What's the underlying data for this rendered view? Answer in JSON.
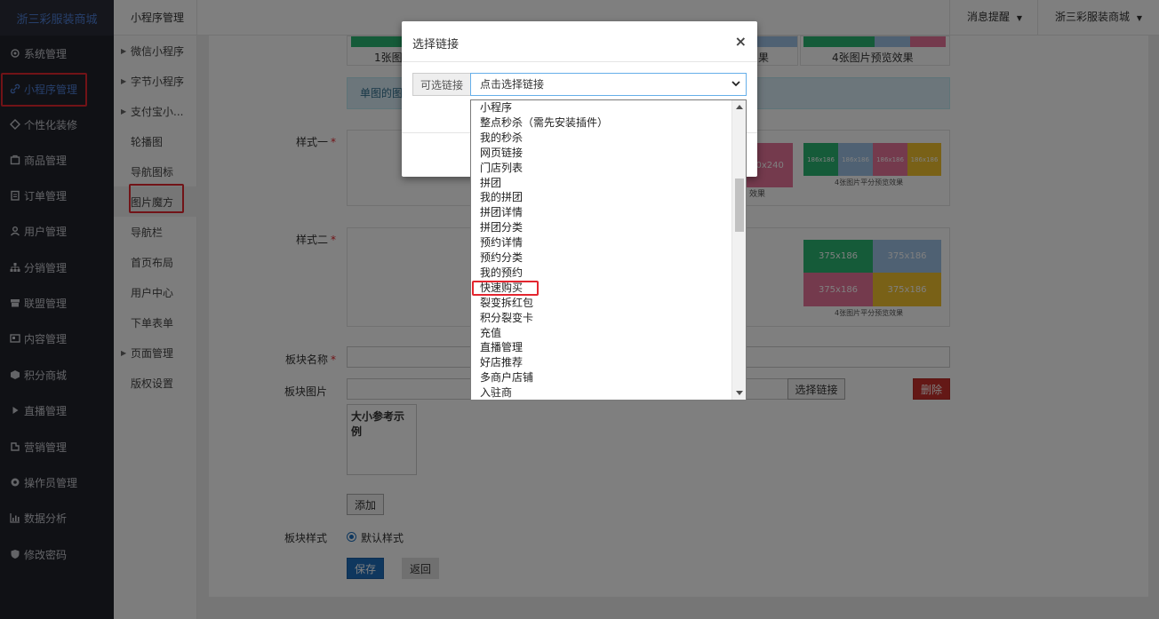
{
  "brand": "浙三彩服装商城",
  "nav": [
    {
      "label": "系统管理",
      "icon": "gear-icon"
    },
    {
      "label": "小程序管理",
      "icon": "link-icon"
    },
    {
      "label": "个性化装修",
      "icon": "diamond-icon"
    },
    {
      "label": "商品管理",
      "icon": "box-icon"
    },
    {
      "label": "订单管理",
      "icon": "clipboard-icon"
    },
    {
      "label": "用户管理",
      "icon": "user-icon"
    },
    {
      "label": "分销管理",
      "icon": "sitemap-icon"
    },
    {
      "label": "联盟管理",
      "icon": "store-icon"
    },
    {
      "label": "内容管理",
      "icon": "newspaper-icon"
    },
    {
      "label": "积分商城",
      "icon": "cube-icon"
    },
    {
      "label": "直播管理",
      "icon": "play-icon"
    },
    {
      "label": "营销管理",
      "icon": "stamp-icon"
    },
    {
      "label": "操作员管理",
      "icon": "cog-icon"
    },
    {
      "label": "数据分析",
      "icon": "bar-chart-icon"
    },
    {
      "label": "修改密码",
      "icon": "shield-icon"
    }
  ],
  "subnav": {
    "title": "小程序管理",
    "items": [
      {
        "label": "微信小程序",
        "arrow": true
      },
      {
        "label": "字节小程序",
        "arrow": true
      },
      {
        "label": "支付宝小...",
        "arrow": true
      },
      {
        "label": "轮播图",
        "arrow": false
      },
      {
        "label": "导航图标",
        "arrow": false
      },
      {
        "label": "图片魔方",
        "arrow": false
      },
      {
        "label": "导航栏",
        "arrow": false
      },
      {
        "label": "首页布局",
        "arrow": false
      },
      {
        "label": "用户中心",
        "arrow": false
      },
      {
        "label": "下单表单",
        "arrow": false
      },
      {
        "label": "页面管理",
        "arrow": true
      },
      {
        "label": "版权设置",
        "arrow": false
      }
    ]
  },
  "topbar": {
    "notifications": "消息提醒",
    "store": "浙三彩服装商城"
  },
  "content": {
    "preview1_caption_left": "1张图",
    "preview1_caption_mid": "果",
    "preview1_caption_right": "4张图片预览效果",
    "info_text": "单图的图",
    "style1_label": "样式一",
    "style1_tile_text_a": "50x240",
    "style1_caption_mid": "效果",
    "style1_tiles": [
      "186x186",
      "186x186",
      "186x186",
      "186x186"
    ],
    "style1_caption_right": "4张图片平分预览效果",
    "style2_label": "样式二",
    "style2_tiles": [
      "375x186",
      "375x186",
      "375x186",
      "375x186"
    ],
    "style2_caption_right": "4张图片平分预览效果",
    "block_name_label": "板块名称",
    "block_image_label": "板块图片",
    "choose_link_button": "选择链接",
    "delete_button": "删除",
    "size_example": "大小参考示例",
    "add_button": "添加",
    "block_style_label": "板块样式",
    "default_style": "默认样式",
    "save_button": "保存",
    "back_button": "返回"
  },
  "modal": {
    "title": "选择链接",
    "close": "×",
    "addon": "可选链接",
    "select_value": "点击选择链接",
    "options": [
      "小程序",
      "整点秒杀（需先安装插件）",
      "我的秒杀",
      "网页链接",
      "门店列表",
      "拼团",
      "我的拼团",
      "拼团详情",
      "拼团分类",
      "预约详情",
      "预约分类",
      "我的预约",
      "快速购买",
      "裂变拆红包",
      "积分裂变卡",
      "充值",
      "直播管理",
      "好店推荐",
      "多商户店铺",
      "入驻商"
    ]
  },
  "colors": {
    "green": "#2bb673",
    "blue_light": "#9ec3e6",
    "pink": "#e8749a",
    "yellow": "#f2c32f",
    "highlight": "#e3262f"
  }
}
